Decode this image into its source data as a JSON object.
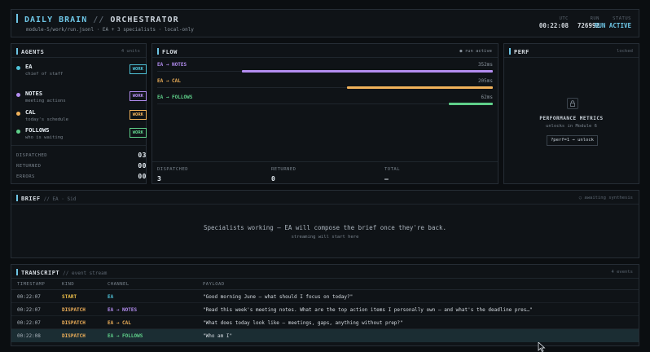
{
  "header": {
    "title_accent": "DAILY BRAIN",
    "title_sep": "//",
    "title_main": "ORCHESTRATOR",
    "meta": "module-5/work/run.jsonl  ·  EA + 3 specialists  ·  local-only",
    "stats": [
      {
        "key": "UTC",
        "value": "00:22:08"
      },
      {
        "key": "RUN",
        "value": "726992"
      },
      {
        "key": "STATUS",
        "value": "RUN ACTIVE"
      }
    ]
  },
  "agents": {
    "title": "AGENTS",
    "count": "4 units",
    "items": [
      {
        "name": "EA",
        "desc": "chief of staff",
        "badge": "WORK",
        "color": "#4fc3d9"
      },
      {
        "name": "NOTES",
        "desc": "meeting actions",
        "badge": "WORK",
        "color": "#b38df0"
      },
      {
        "name": "CAL",
        "desc": "today's schedule",
        "badge": "WORK",
        "color": "#f0b15a"
      },
      {
        "name": "FOLLOWS",
        "desc": "who is waiting",
        "badge": "WORK",
        "color": "#5fd08a"
      }
    ],
    "counters": [
      {
        "label": "DISPATCHED",
        "value": "03"
      },
      {
        "label": "RETURNED",
        "value": "00"
      },
      {
        "label": "ERRORS",
        "value": "00"
      }
    ]
  },
  "flow": {
    "title": "FLOW",
    "status": "● run active",
    "rows": [
      {
        "label": "EA → NOTES",
        "ms": "352ms",
        "value": 352,
        "color": "#b38df0"
      },
      {
        "label": "EA → CAL",
        "ms": "205ms",
        "value": 205,
        "color": "#f0b15a"
      },
      {
        "label": "EA → FOLLOWS",
        "ms": "62ms",
        "value": 62,
        "color": "#5fd08a"
      }
    ],
    "max_value": 352,
    "stats": [
      {
        "label": "DISPATCHED",
        "value": "3"
      },
      {
        "label": "RETURNED",
        "value": "0"
      },
      {
        "label": "TOTAL",
        "value": "—"
      }
    ]
  },
  "perf": {
    "title": "PERF",
    "state": "locked",
    "heading": "PERFORMANCE METRICS",
    "sub": "unlocks in Module 6",
    "button": "?perf=1 → unlock"
  },
  "brief": {
    "title": "BRIEF",
    "sub": "// EA · Sid",
    "status": "○ awaiting synthesis",
    "message": "Specialists working — EA will compose the brief once they're back.",
    "hint": "streaming will start here"
  },
  "transcript": {
    "title": "TRANSCRIPT",
    "sub": "// event stream",
    "count": "4 events",
    "columns": [
      "TIMESTAMP",
      "KIND",
      "CHANNEL",
      "PAYLOAD"
    ],
    "rows": [
      {
        "ts": "00:22:07",
        "kind": "START",
        "kind_color": "#f0c04a",
        "channel": "EA",
        "channel_color": "#4fc3d9",
        "payload": "\"Good morning June — what should I focus on today?\""
      },
      {
        "ts": "00:22:07",
        "kind": "DISPATCH",
        "kind_color": "#f0b15a",
        "channel": "EA → NOTES",
        "channel_color": "#b38df0",
        "payload": "\"Read this week's meeting notes. What are the top action items I personally own — and what's the deadline pres…\""
      },
      {
        "ts": "00:22:07",
        "kind": "DISPATCH",
        "kind_color": "#f0b15a",
        "channel": "EA → CAL",
        "channel_color": "#f0b15a",
        "payload": "\"What does today look like — meetings, gaps, anything without prep?\""
      },
      {
        "ts": "00:22:08",
        "kind": "DISPATCH",
        "kind_color": "#f0b15a",
        "channel": "EA → FOLLOWS",
        "channel_color": "#5fd08a",
        "payload": "\"Who am I\""
      }
    ]
  }
}
